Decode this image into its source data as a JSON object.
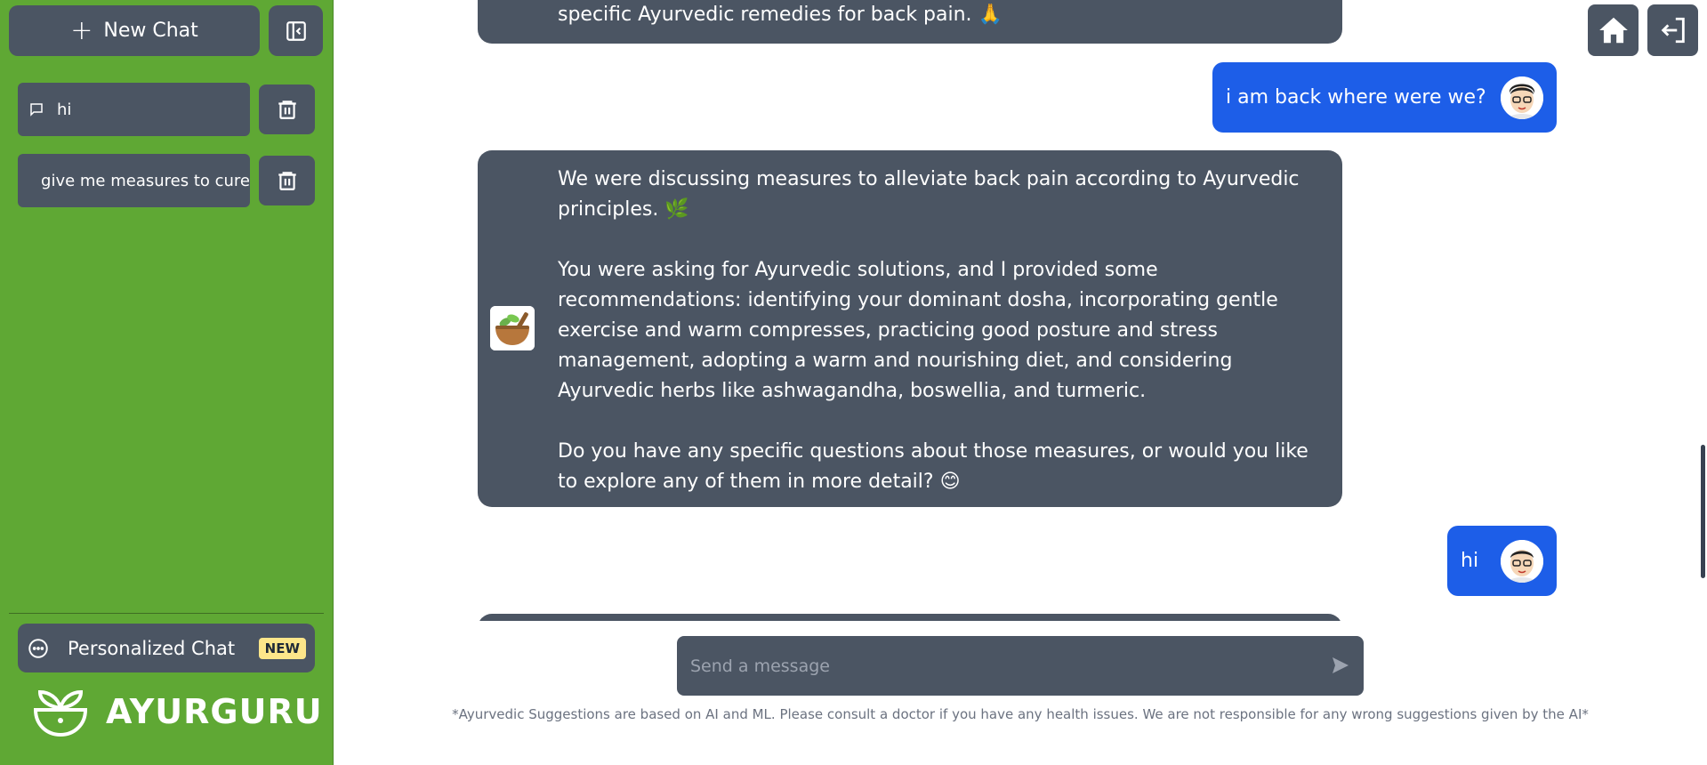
{
  "sidebar": {
    "new_chat_label": "New Chat",
    "chats": [
      {
        "title": "hi"
      },
      {
        "title": "give me measures to cure"
      }
    ],
    "personalized_label": "Personalized Chat",
    "new_badge": "NEW",
    "brand": "AYURGURU"
  },
  "messages": {
    "top_bot_fragment": "specific Ayurvedic remedies for back pain. 🙏",
    "user_1": "i am back where were we?",
    "bot_p1": "We were discussing measures to alleviate back pain according to Ayurvedic principles. 🌿",
    "bot_p2": "You were asking for Ayurvedic solutions, and I provided some recommendations: identifying your dominant dosha, incorporating gentle exercise and warm compresses, practicing good posture and stress management, adopting a warm and nourishing diet, and considering Ayurvedic herbs like ashwagandha, boswellia, and turmeric.",
    "bot_p3": "Do you have any specific questions about those measures, or would you like to explore any of them in more detail? 😊",
    "user_2": "hi"
  },
  "input": {
    "placeholder": "Send a message"
  },
  "disclaimer": "*Ayurvedic Suggestions are based on AI and ML. Please consult a doctor if you have any health issues. We are not responsible for any wrong suggestions given by the AI*",
  "icons": {
    "home": "home-icon",
    "logout": "logout-icon",
    "send": "send-icon",
    "trash": "trash-icon",
    "chat": "chat-bubble-icon"
  },
  "colors": {
    "sidebar_bg": "#5fa834",
    "panel": "#4b5563",
    "user_bubble": "#1d5ee8",
    "badge": "#fde68a"
  }
}
